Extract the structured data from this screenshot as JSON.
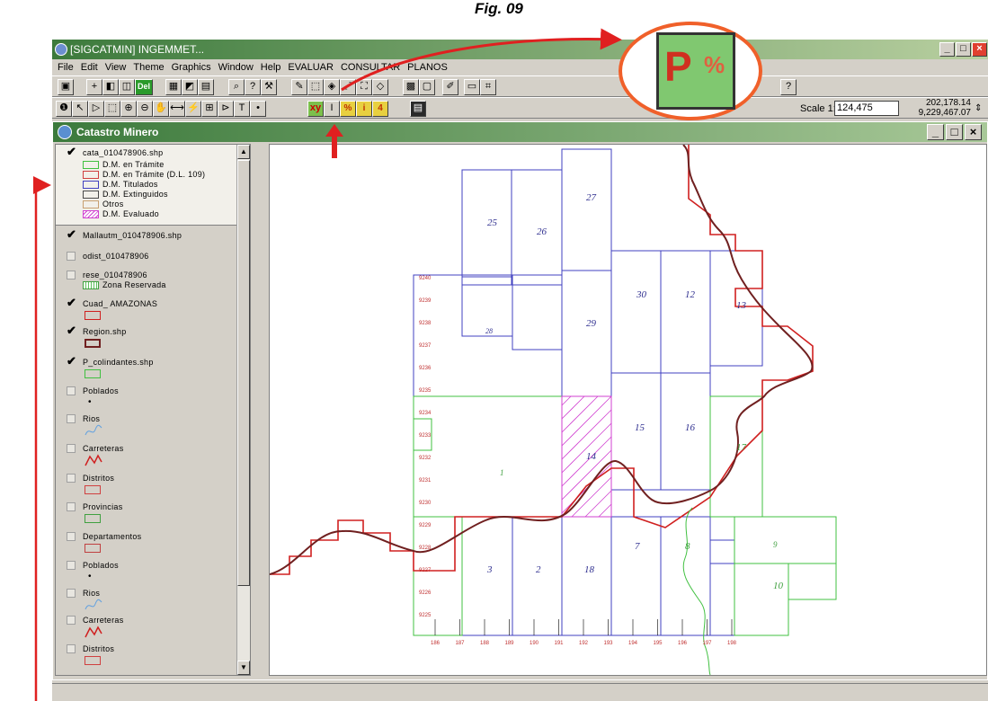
{
  "figure": {
    "caption": "Fig. 09"
  },
  "window": {
    "title": "[SIGCATMIN] INGEMMET..."
  },
  "menu": [
    "File",
    "Edit",
    "View",
    "Theme",
    "Graphics",
    "Window",
    "Help",
    "EVALUAR",
    "CONSULTAR",
    "PLANOS"
  ],
  "toolbar": {
    "del_label": "Del",
    "scale_label": "Scale 1:",
    "scale_value": "124,475",
    "coord_x": "202,178.14",
    "coord_y": "9,229,467.07"
  },
  "child": {
    "title": "Catastro Minero"
  },
  "toc": {
    "cata_name": "cata_010478906.shp",
    "cata_legend": [
      "D.M. en Trámite",
      "D.M. en Trámite (D.L. 109)",
      "D.M. Titulados",
      "D.M. Extinguidos",
      "Otros",
      "D.M. Evaluado"
    ],
    "mallautm": "Mallautm_010478906.shp",
    "odist": "odist_010478906",
    "rese": "rese_010478906",
    "rese_legend": "Zona Reservada",
    "cuad": "Cuad_ AMAZONAS",
    "region": "Region.shp",
    "pcol": "P_colindantes.shp",
    "poblados": "Poblados",
    "rios": "Rios",
    "carreteras": "Carreteras",
    "distritos": "Distritos",
    "provincias": "Provincias",
    "departamentos": "Departamentos",
    "poblados2": "Poblados",
    "rios2": "Rios",
    "carreteras2": "Carreteras",
    "distritos2": "Distritos"
  },
  "map": {
    "labels": [
      "25",
      "26",
      "27",
      "30",
      "12",
      "13",
      "28",
      "29",
      "15",
      "16",
      "17",
      "14",
      "1",
      "3",
      "2",
      "18",
      "7",
      "8",
      "9",
      "10"
    ],
    "north_ticks": [
      "9240",
      "9239",
      "9238",
      "9237",
      "9236",
      "9235",
      "9234",
      "9233",
      "9232",
      "9231",
      "9230",
      "9229",
      "9228",
      "9227",
      "9226",
      "9225"
    ],
    "east_ticks": [
      "186",
      "187",
      "188",
      "189",
      "190",
      "191",
      "192",
      "193",
      "194",
      "195",
      "196",
      "197",
      "198"
    ]
  },
  "colors": {
    "tramite": "#40c040",
    "titulados": "#4040c0",
    "evaluado": "#d040d0",
    "cuadrangulo": "#d02020",
    "region": "#702020",
    "callout": "#f0602a",
    "arrow": "#e02020"
  }
}
